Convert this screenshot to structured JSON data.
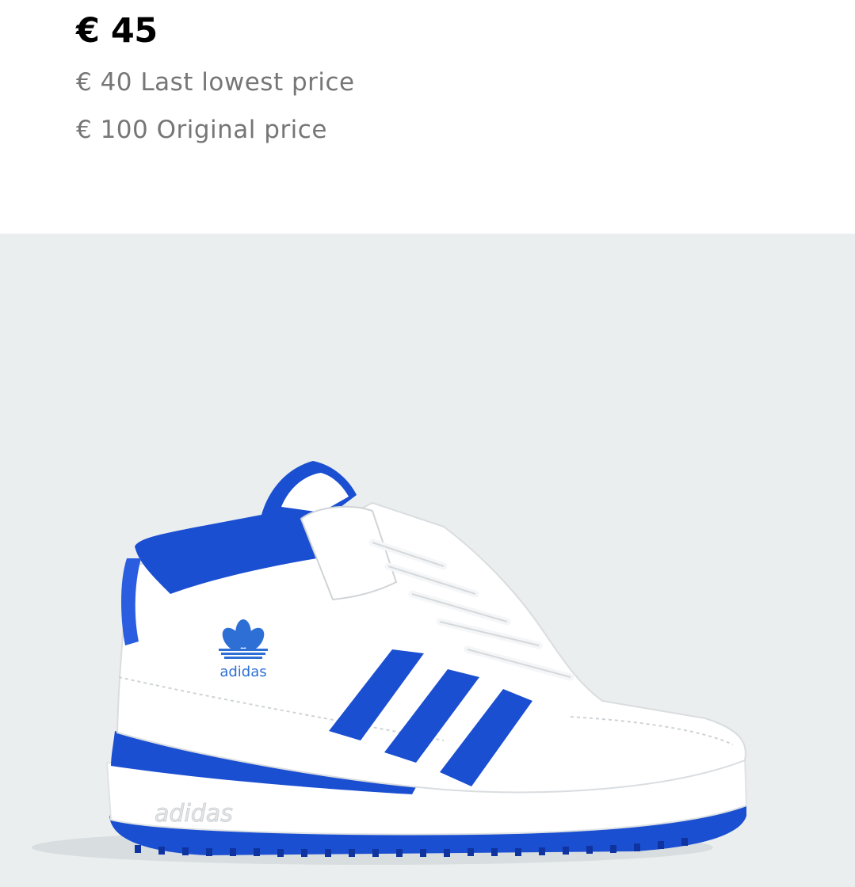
{
  "product": {
    "price": {
      "current": "€ 45",
      "last_lowest": "€ 40 Last lowest price",
      "original": "€ 100 Original price"
    },
    "image": {
      "brand_logo_text": "adidas",
      "midsole_text": "adidas",
      "colors": {
        "background": "#eaeeef",
        "upper": "#ffffff",
        "accent_blue": "#1b4fd1"
      }
    }
  }
}
